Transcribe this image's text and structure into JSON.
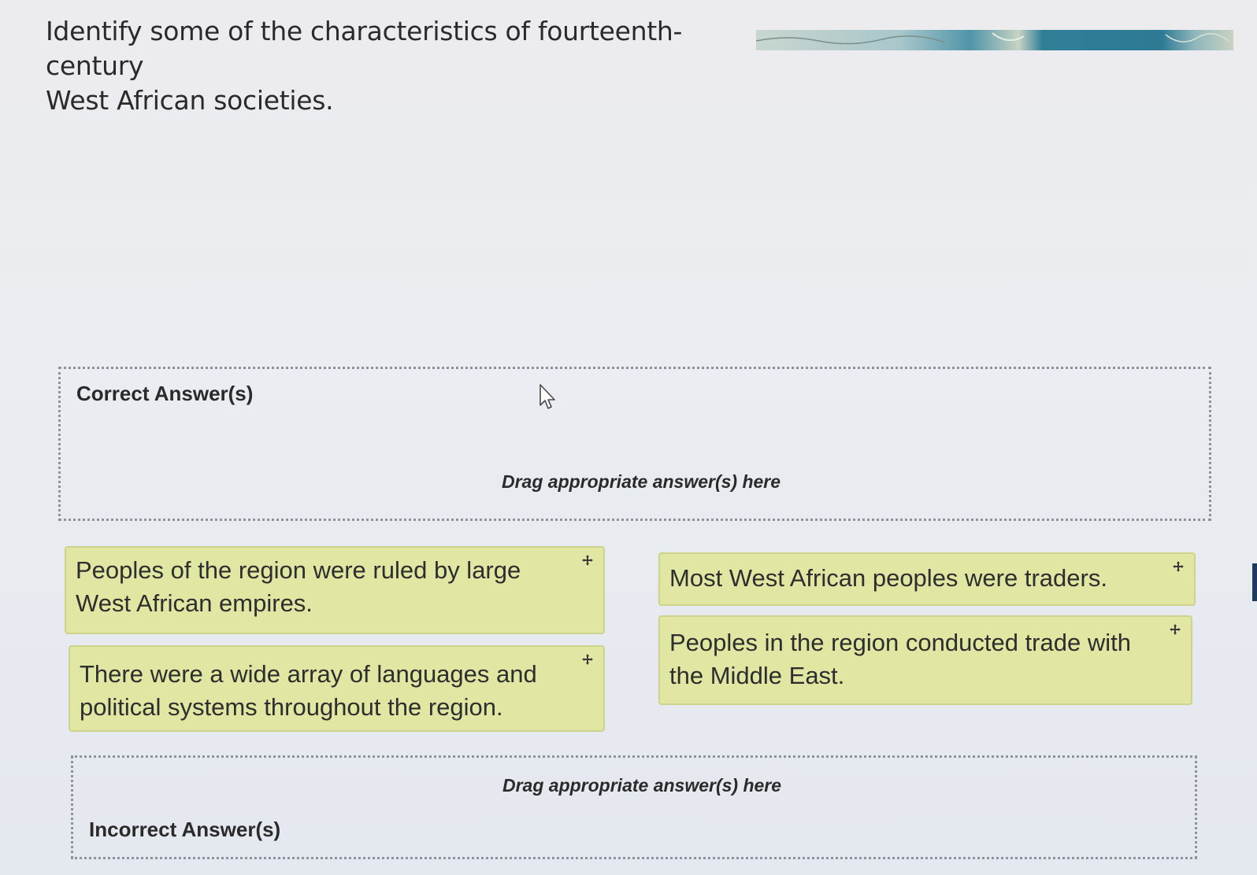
{
  "question": {
    "line1": "Identify some of the characteristics of fourteenth-century",
    "line2": "West African societies."
  },
  "header_image": {
    "icon": "map-icon"
  },
  "correct_zone": {
    "title": "Correct Answer(s)",
    "hint": "Drag appropriate answer(s) here"
  },
  "incorrect_zone": {
    "title": "Incorrect Answer(s)",
    "hint": "Drag appropriate answer(s) here"
  },
  "answers": [
    {
      "text": "Peoples of the region were ruled by large West African empires.",
      "icon": "move-icon"
    },
    {
      "text": "There were a wide array of languages and political systems throughout the region.",
      "icon": "move-icon"
    },
    {
      "text": "Most West African peoples were traders.",
      "icon": "move-icon"
    },
    {
      "text": "Peoples in the region conducted trade with the Middle East.",
      "icon": "move-icon"
    }
  ],
  "colors": {
    "card_background": "#e1e6a2",
    "card_border": "#cdd38a",
    "dropzone_border": "#8d939a",
    "map_water": "#2f7e96"
  }
}
